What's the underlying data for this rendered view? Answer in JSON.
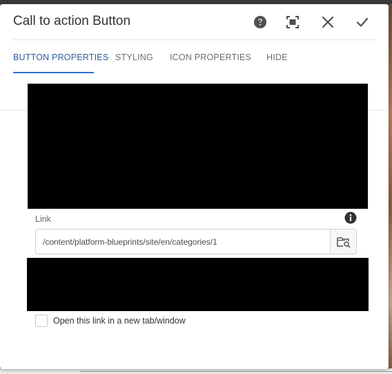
{
  "dialog": {
    "title": "Call to action Button",
    "header_buttons": [
      "help-icon",
      "fullscreen-icon",
      "close-icon",
      "checkmark-icon"
    ]
  },
  "tabs": [
    {
      "label": "BUTTON PROPERTIES",
      "active": true
    },
    {
      "label": "STYLING",
      "active": false
    },
    {
      "label": "ICON PROPERTIES",
      "active": false
    },
    {
      "label": "HIDE",
      "active": false
    }
  ],
  "link_field": {
    "label": "Link",
    "value": "/content/platform-blueprints/site/en/categories/1",
    "info_icon": "info-icon",
    "browse_icon": "folder-search-icon"
  },
  "new_tab_option": {
    "label": "Open this link in a new tab/window",
    "checked": false
  },
  "colors": {
    "accent": "#2d6fd8",
    "active_tab_text": "#2c5c9c",
    "redacted": "#000000"
  }
}
